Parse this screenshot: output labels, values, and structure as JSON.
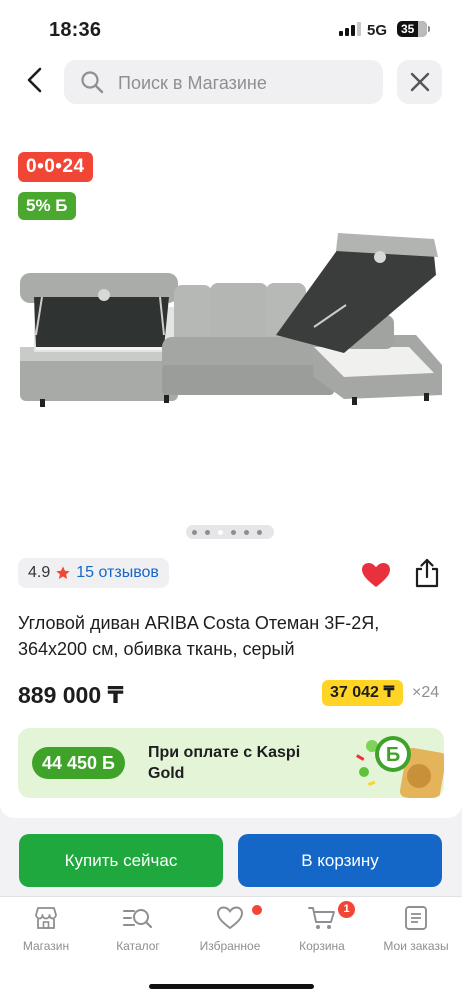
{
  "status_bar": {
    "time": "18:36",
    "network": "5G",
    "battery": "35"
  },
  "search": {
    "placeholder": "Поиск в Магазине"
  },
  "product": {
    "promo_badge": "0•0•24",
    "bonus_badge": "5% Б",
    "gallery": {
      "total_images": 6,
      "active_index": 2
    },
    "rating": "4.9",
    "reviews": "15 отзывов",
    "title": "Угловой диван ARIBA Costa Отеман 3F-2Я, 364x200 см, обивка ткань, серый",
    "price": "889 000 ₸",
    "installment_amount": "37 042 ₸",
    "installment_months": "×24",
    "kaspi_gold": {
      "bonus": "44 450 Б",
      "text": "При оплате с Kaspi Gold"
    }
  },
  "actions": {
    "buy_now": "Купить сейчас",
    "add_to_cart": "В корзину"
  },
  "tabbar": {
    "items": [
      {
        "label": "Магазин",
        "icon": "shop-icon"
      },
      {
        "label": "Каталог",
        "icon": "catalog-search-icon"
      },
      {
        "label": "Избранное",
        "icon": "heart-outline-icon",
        "dot": true
      },
      {
        "label": "Корзина",
        "icon": "cart-icon",
        "count": "1"
      },
      {
        "label": "Мои заказы",
        "icon": "orders-icon"
      }
    ]
  },
  "colors": {
    "green": "#1fa83d",
    "blue": "#1567c7",
    "red": "#f14635",
    "yellow": "#ffd424"
  }
}
